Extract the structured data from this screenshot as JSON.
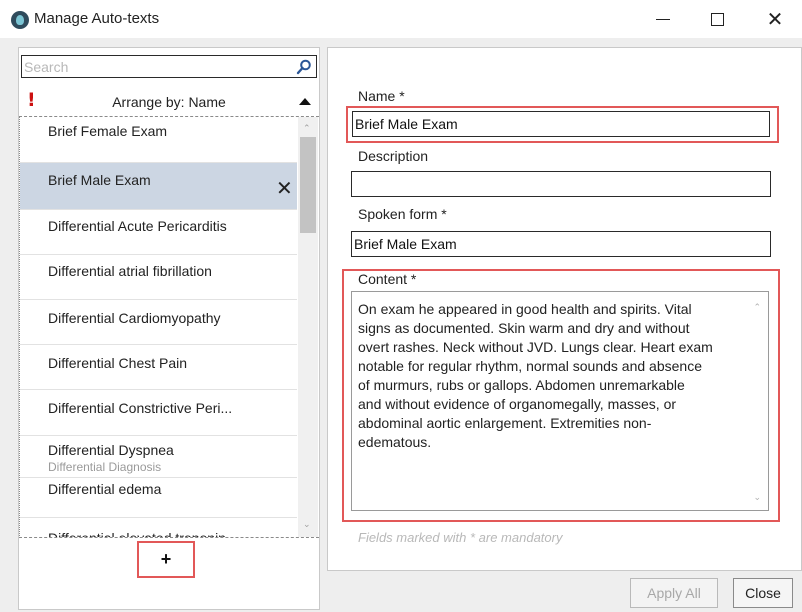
{
  "window": {
    "title": "Manage Auto-texts",
    "controls": {
      "minimize": "—",
      "maximize": "☐",
      "close": "✕"
    }
  },
  "sidebar": {
    "search": {
      "placeholder": "Search",
      "value": ""
    },
    "arrange_label": "Arrange by: Name",
    "items": [
      {
        "label": "Brief Female Exam",
        "sublabel": ""
      },
      {
        "label": "Brief Male Exam",
        "sublabel": "",
        "selected": true
      },
      {
        "label": "Differential Acute Pericarditis",
        "sublabel": ""
      },
      {
        "label": "Differential atrial fibrillation",
        "sublabel": ""
      },
      {
        "label": "Differential Cardiomyopathy",
        "sublabel": ""
      },
      {
        "label": "Differential Chest Pain",
        "sublabel": ""
      },
      {
        "label": "Differential Constrictive Peri...",
        "sublabel": ""
      },
      {
        "label": "Differential Dyspnea",
        "sublabel": "Differential Diagnosis"
      },
      {
        "label": "Differential edema",
        "sublabel": ""
      },
      {
        "label": "Differential elevated troponin",
        "sublabel": ""
      }
    ],
    "add_label": "+"
  },
  "form": {
    "name_label": "Name *",
    "name_value": "Brief Male Exam",
    "description_label": "Description",
    "description_value": "",
    "spoken_label": "Spoken form *",
    "spoken_value": "Brief Male Exam",
    "content_label": "Content *",
    "content_value": "On exam he appeared in good health and spirits.  Vital\nsigns as documented. Skin warm and dry and without\novert rashes. Neck without JVD.  Lungs clear. Heart exam\nnotable for regular rhythm, normal sounds and absence\nof murmurs, rubs or gallops.  Abdomen unremarkable\nand without evidence of organomegally, masses, or\nabdominal aortic enlargement.  Extremities non-\nedematous.",
    "mandatory_note": "Fields marked with * are mandatory"
  },
  "footer": {
    "apply_label": "Apply All",
    "close_label": "Close"
  },
  "colors": {
    "highlight": "#e25858",
    "selected_row": "#ccd6e3",
    "required_marker": "#cc1111"
  }
}
